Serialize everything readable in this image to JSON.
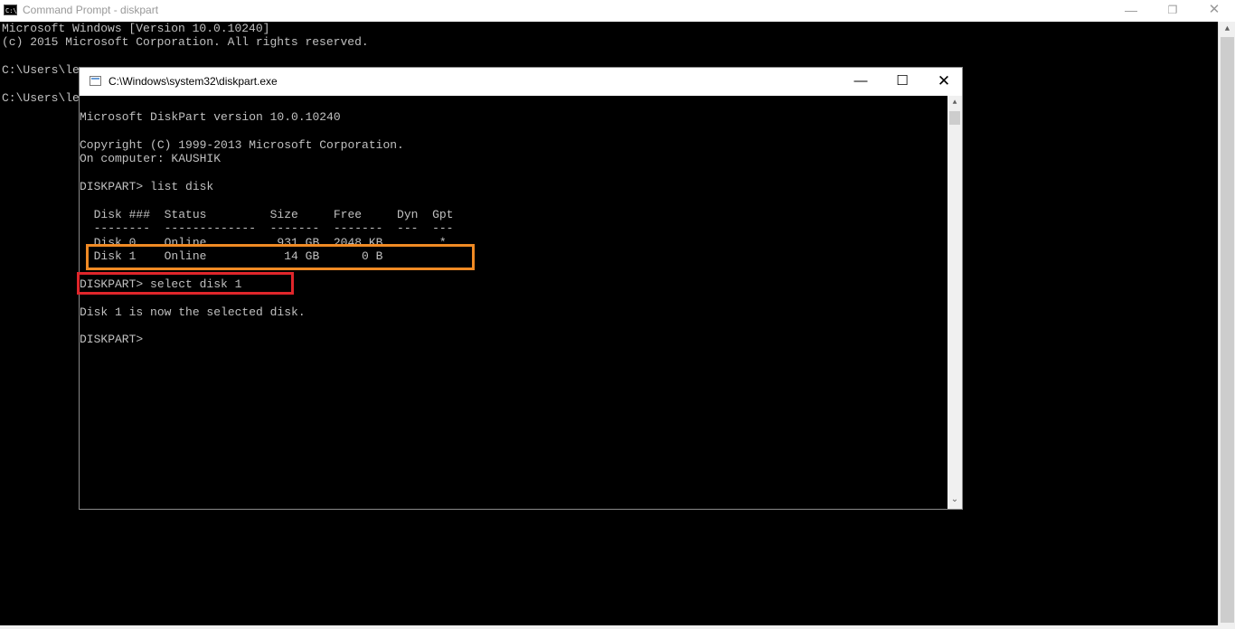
{
  "outer_window": {
    "title": "Command Prompt - diskpart",
    "console_lines": [
      "Microsoft Windows [Version 10.0.10240]",
      "(c) 2015 Microsoft Corporation. All rights reserved.",
      "",
      "C:\\Users\\le",
      "",
      "C:\\Users\\le"
    ],
    "controls": {
      "minimize": "—",
      "restore": "❐",
      "close": "✕"
    }
  },
  "inner_window": {
    "title": "C:\\Windows\\system32\\diskpart.exe",
    "controls": {
      "minimize": "—",
      "maximize": "☐",
      "close": "✕"
    },
    "console_lines": [
      "",
      "Microsoft DiskPart version 10.0.10240",
      "",
      "Copyright (C) 1999-2013 Microsoft Corporation.",
      "On computer: KAUSHIK",
      "",
      "DISKPART> list disk",
      "",
      "  Disk ###  Status         Size     Free     Dyn  Gpt",
      "  --------  -------------  -------  -------  ---  ---",
      "  Disk 0    Online          931 GB  2048 KB        *",
      "  Disk 1    Online           14 GB      0 B",
      "",
      "DISKPART> select disk 1",
      "",
      "Disk 1 is now the selected disk.",
      "",
      "DISKPART>"
    ]
  },
  "colors": {
    "console_bg": "#000000",
    "console_text": "#c0c0c0",
    "highlight_disk_row": "#f08a24",
    "highlight_command": "#e0262b"
  },
  "icons": [
    "cmd-icon",
    "console-window-icon",
    "minimize-icon",
    "maximize-icon",
    "close-icon",
    "scroll-up-icon",
    "scroll-down-icon"
  ]
}
